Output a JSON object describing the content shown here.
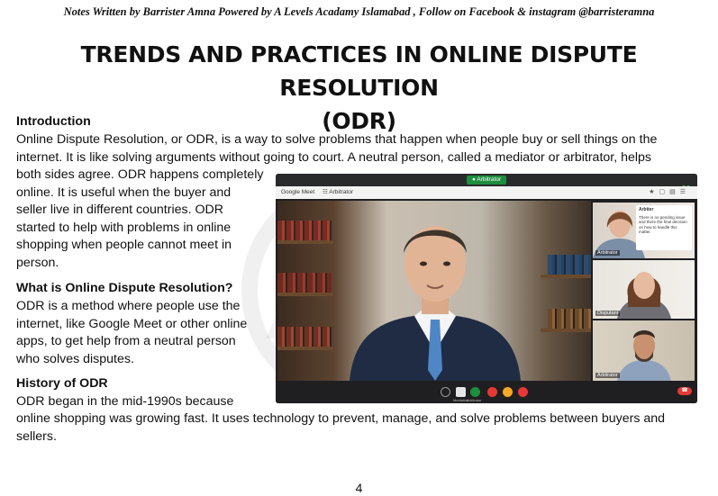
{
  "header": {
    "note": "Notes Written by Barrister Amna Powered by A Levels Acadamy Islamabad , Follow on Facebook & instagram @barristeramna"
  },
  "title": {
    "line1": "TRENDS AND PRACTICES IN ONLINE DISPUTE RESOLUTION",
    "line2": "(ODR)"
  },
  "sections": {
    "introduction": {
      "heading": "Introduction",
      "full_lines": [
        "Online Dispute Resolution, or ODR, is a way to solve problems that happen when people buy or sell things on the",
        "internet. It is like solving arguments without going to court. A neutral person, called a mediator or arbitrator, helps"
      ],
      "narrow_lines": [
        "both sides agree. ODR happens completely",
        "online. It is useful when the buyer and",
        "seller live in different countries. ODR",
        "started to help with problems in online",
        "shopping when people cannot meet in",
        "person."
      ]
    },
    "what_is": {
      "heading": "What is Online Dispute Resolution?",
      "lines": [
        "ODR is a method where people use the",
        "internet, like Google Meet or other online",
        "apps, to get help from a neutral person",
        "who solves disputes."
      ]
    },
    "history": {
      "heading": "History of ODR",
      "narrow_line": "ODR began in the mid-1990s because",
      "full_lines": [
        "online shopping was growing fast. It uses technology to prevent, manage, and solve problems between buyers and",
        "sellers."
      ]
    }
  },
  "figure": {
    "top_pill": "Arbitrator",
    "app_name": "Google Meet",
    "tab_name": "Arbitrator",
    "chat_title": "Arbiter",
    "chat_text": "There is no pending issue and there the final decision on how to handle this matter.",
    "tile_labels": [
      "Arbitrator",
      "Disputant",
      "Arbitrator"
    ],
    "control_labels": [
      "Mediation",
      "Arbitrator"
    ],
    "colors": {
      "pill_green": "#1e8e3e",
      "end_call_red": "#e53935",
      "frame_dark": "#1f1f21"
    }
  },
  "footer": {
    "page_number": "4"
  }
}
